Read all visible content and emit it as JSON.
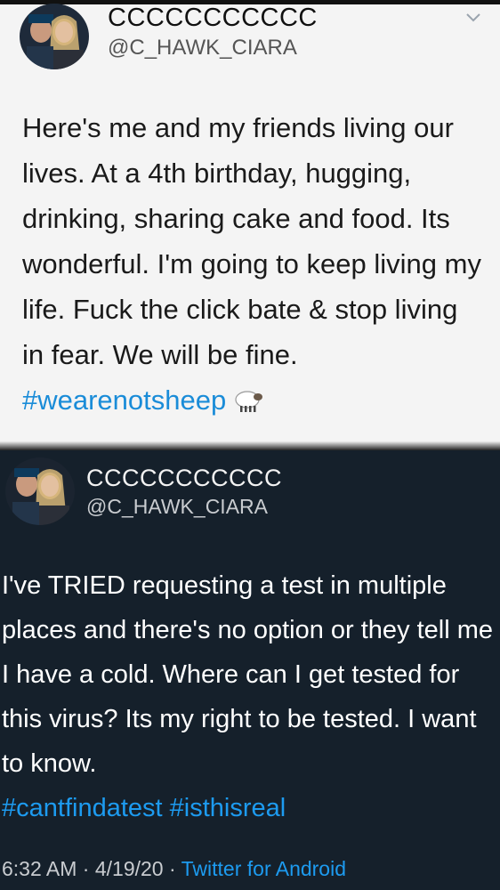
{
  "tweet1": {
    "display_name": "CCCCCCCCCCC",
    "handle": "@C_HAWK_CIARA",
    "text": "Here's me and my friends living our lives. At a 4th birthday, hugging, drinking, sharing cake and food. Its wonderful. I'm going to keep living my life. Fuck the click bate & stop living in fear. We will be fine.",
    "hashtag": "#wearenotsheep",
    "emoji_icon": "sheep-icon",
    "menu_icon": "chevron-down-icon"
  },
  "tweet2": {
    "display_name": "CCCCCCCCCCC",
    "handle": "@C_HAWK_CIARA",
    "text": "I've TRIED requesting a test in multiple places and there's no option or they tell me I have a cold. Where can I get tested for this virus? Its my right to be tested. I want to know.",
    "hashtags": "#cantfindatest #isthisreal",
    "time": "6:32 AM",
    "date": "4/19/20",
    "separator": "·",
    "source": "Twitter for Android"
  },
  "colors": {
    "light_bg": "#f4f4f4",
    "dark_bg": "#15202b",
    "link_blue": "#1d9bf0"
  }
}
